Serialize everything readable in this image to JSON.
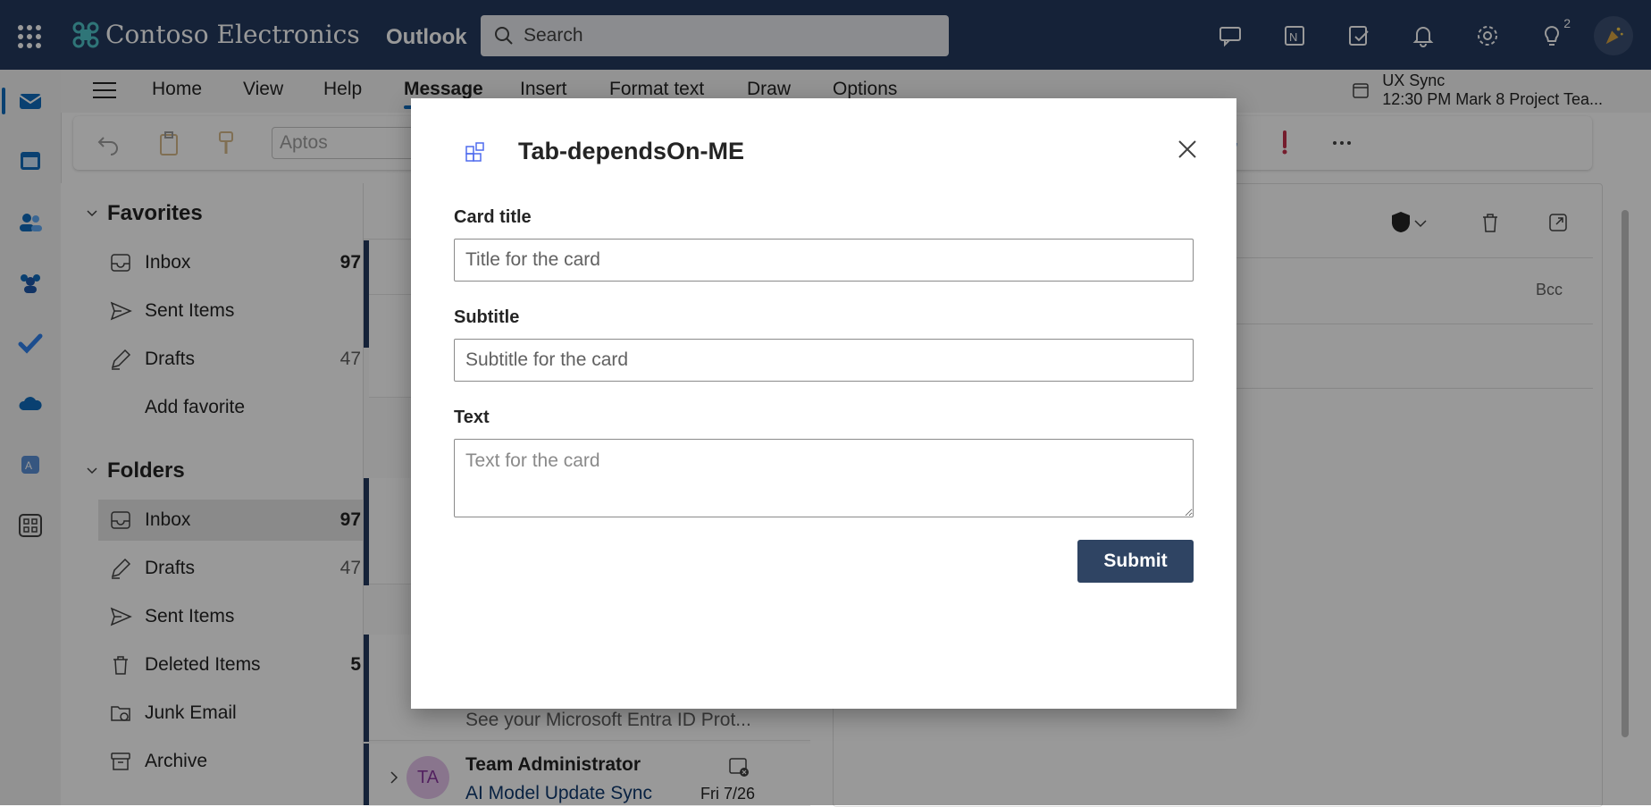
{
  "topbar": {
    "brand_name": "Contoso Electronics",
    "app_name": "Outlook",
    "search_placeholder": "Search",
    "tips_badge": "2"
  },
  "ribbon": {
    "tabs": [
      "Home",
      "View",
      "Help",
      "Message",
      "Insert",
      "Format text",
      "Draw",
      "Options"
    ],
    "active_tab": "Message",
    "font_name": "Aptos",
    "meeting_title": "UX Sync",
    "meeting_detail": "12:30 PM Mark 8 Project Tea..."
  },
  "folders": {
    "favorites_header": "Favorites",
    "favorites": [
      {
        "label": "Inbox",
        "count": "97"
      },
      {
        "label": "Sent Items",
        "count": ""
      },
      {
        "label": "Drafts",
        "count": "47"
      },
      {
        "label": "Add favorite",
        "count": ""
      }
    ],
    "folders_header": "Folders",
    "items": [
      {
        "label": "Inbox",
        "count": "97"
      },
      {
        "label": "Drafts",
        "count": "47"
      },
      {
        "label": "Sent Items",
        "count": ""
      },
      {
        "label": "Deleted Items",
        "count": "5"
      },
      {
        "label": "Junk Email",
        "count": ""
      },
      {
        "label": "Archive",
        "count": ""
      }
    ]
  },
  "messages": {
    "preview_1": "See your Microsoft Entra ID Prot...",
    "row_2": {
      "avatar": "TA",
      "sender": "Team Administrator",
      "subject": "AI Model Update Sync",
      "date": "Fri 7/26"
    }
  },
  "reading": {
    "bcc": "Bcc"
  },
  "modal": {
    "title": "Tab-dependsOn-ME",
    "card_title_label": "Card title",
    "card_title_placeholder": "Title for the card",
    "subtitle_label": "Subtitle",
    "subtitle_placeholder": "Subtitle for the card",
    "text_label": "Text",
    "text_placeholder": "Text for the card",
    "submit_label": "Submit"
  },
  "colors": {
    "topbar": "#243a5e",
    "accent": "#0f6cbd",
    "submit": "#2f4463"
  }
}
